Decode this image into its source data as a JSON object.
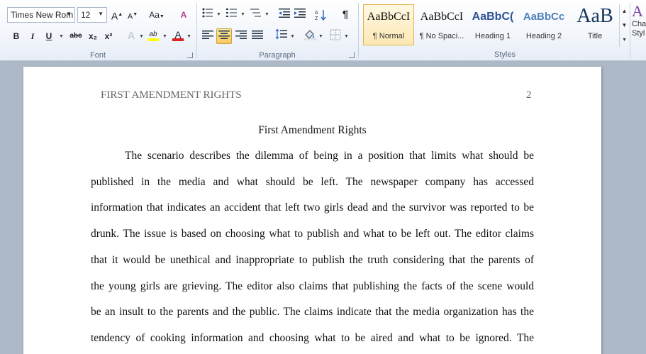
{
  "ribbon": {
    "font_group": {
      "label": "Font",
      "font_name": "Times New Rom",
      "font_size": "12",
      "buttons": {
        "grow_font": "A",
        "shrink_font": "A",
        "change_case": "Aa",
        "clear_formatting": "A",
        "bold": "B",
        "italic": "I",
        "underline": "U",
        "strikethrough": "abc",
        "subscript": "x₂",
        "superscript": "x²",
        "text_effects": "A",
        "highlight": "ab",
        "font_color": "A"
      }
    },
    "paragraph_group": {
      "label": "Paragraph",
      "pilcrow": "¶"
    },
    "styles_group": {
      "label": "Styles",
      "styles": [
        {
          "sample": "AaBbCcI",
          "name": "¶ Normal",
          "color": "#111111",
          "selected": true
        },
        {
          "sample": "AaBbCcI",
          "name": "¶ No Spaci...",
          "color": "#111111",
          "selected": false
        },
        {
          "sample": "AaBbC(",
          "name": "Heading 1",
          "color": "#2f5496",
          "selected": false
        },
        {
          "sample": "AaBbCc",
          "name": "Heading 2",
          "color": "#4f81bd",
          "selected": false
        },
        {
          "sample": "AaB",
          "name": "Title",
          "color": "#17365d",
          "selected": false
        }
      ],
      "change_styles_label": "Cha\nStyl"
    }
  },
  "document": {
    "header_left": "FIRST AMENDMENT RIGHTS",
    "page_number": "2",
    "title": "First Amendment Rights",
    "lines": [
      "The scenario describes the dilemma of being in a position that limits what should be",
      "published in the media and what should be left. The newspaper company has accessed",
      "information that indicates an accident that left two girls dead and the survivor was reported to be",
      "drunk. The issue is based on choosing what to publish and what to be left out. The editor claims",
      "that it would be unethical and inappropriate to publish the truth considering that the parents of",
      "the young girls are grieving. The editor also claims that publishing the facts of the scene would",
      "be an insult to the parents and the public. The claims indicate that the media organization has the",
      "tendency of cooking information and choosing what to be aired and what to be ignored. The"
    ]
  },
  "colors": {
    "highlight_bar": "#ffff00",
    "font_color_bar": "#e0201b",
    "active_button": "#f9c95a"
  }
}
